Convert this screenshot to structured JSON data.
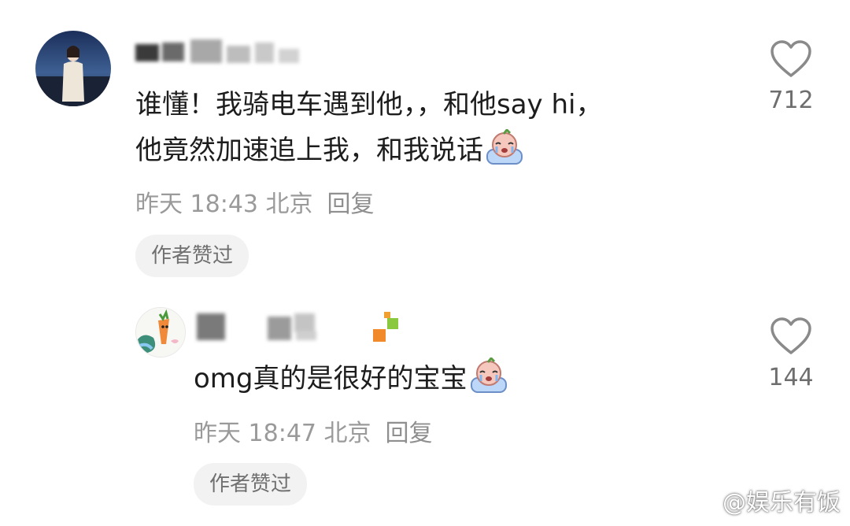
{
  "comment": {
    "line1": "谁懂！我骑电车遇到他，，和他say hi，",
    "line2": "他竟然加速追上我，和我说话",
    "time": "昨天 18:43 北京",
    "reply_label": "回复",
    "badge": "作者赞过",
    "likes": "712"
  },
  "reply": {
    "text": "omg真的是很好的宝宝",
    "time": "昨天 18:47 北京",
    "reply_label": "回复",
    "badge": "作者赞过",
    "likes": "144"
  },
  "watermark": {
    "text": "@娱乐有饭"
  },
  "icons": {
    "like": "heart-outline-icon",
    "emoji": "crying-emoji-icon",
    "watermark": "weibo-logo-icon"
  },
  "colors": {
    "text": "#1d1d1d",
    "meta": "#9a9a9a",
    "badge_bg": "#f2f2f2"
  }
}
